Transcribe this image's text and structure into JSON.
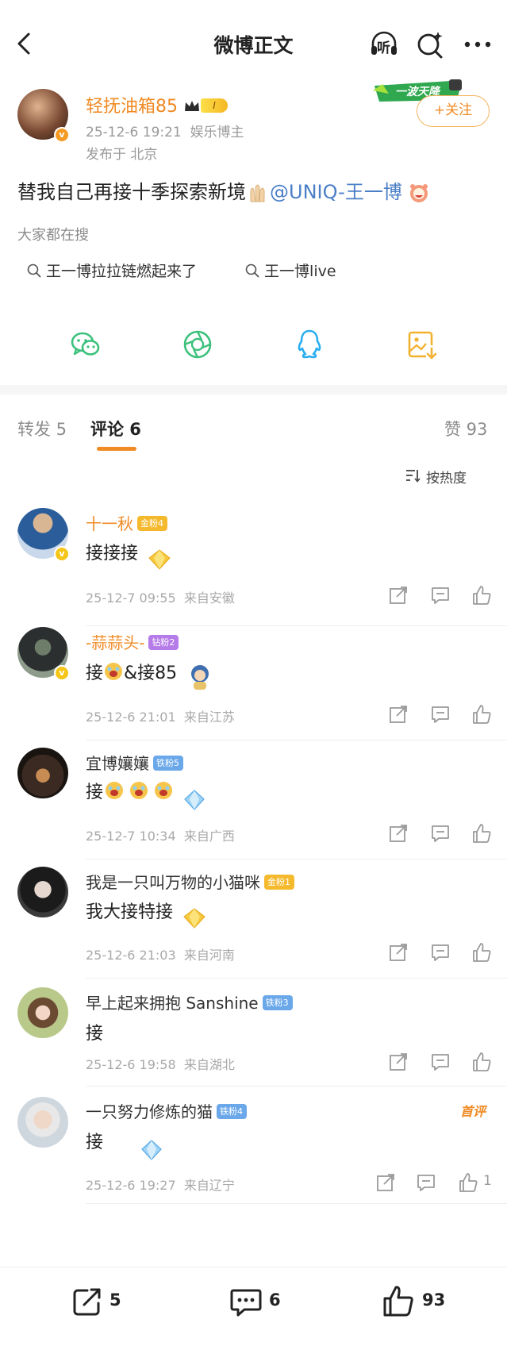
{
  "header": {
    "title": "微博正文",
    "back_icon": "chevron-left-icon",
    "listen_icon": "headphones-listen-icon",
    "listen_label": "听",
    "search_icon": "search-sparkle-icon",
    "more_icon": "more-dots-icon"
  },
  "author": {
    "name": "轻抚油箱85",
    "level_badge": "I",
    "time": "25-12-6 19:21",
    "role": "娱乐博主",
    "location": "发布于 北京",
    "verified_badge": "v",
    "follow_label": "+关注",
    "sticker_text": "一波天降"
  },
  "post": {
    "text": "替我自己再接十季探索新境",
    "mention": "@UNIQ-王一博"
  },
  "hot_search": {
    "label": "大家都在搜",
    "items": [
      "王一博拉拉链燃起来了",
      "王一博live"
    ]
  },
  "share": {
    "icons": [
      "wechat-icon",
      "moments-icon",
      "qq-icon",
      "save-image-icon"
    ]
  },
  "tabs": {
    "repost": "转发 5",
    "comment": "评论 6",
    "like": "赞 93"
  },
  "sort_label": "按热度",
  "comments": [
    {
      "name": "十一秋",
      "badge": "金粉4",
      "badge_color": "#f5b92e",
      "text": "接接接",
      "time": "25-12-7 09:55",
      "location": "来自安徽",
      "orange": true,
      "likes": ""
    },
    {
      "name": "-蒜蒜头-",
      "badge": "钻粉2",
      "badge_color": "#b57be8",
      "text": "接",
      "text2": "&接85",
      "time": "25-12-6 21:01",
      "location": "来自江苏",
      "orange": true,
      "likes": ""
    },
    {
      "name": "宜博孃孃",
      "badge": "铁粉5",
      "badge_color": "#6aa8ea",
      "text": "接",
      "time": "25-12-7 10:34",
      "location": "来自广西",
      "orange": false,
      "likes": ""
    },
    {
      "name": "我是一只叫万物的小猫咪",
      "badge": "金粉1",
      "badge_color": "#f5b92e",
      "text": "我大接特接",
      "time": "25-12-6 21:03",
      "location": "来自河南",
      "orange": false,
      "likes": ""
    },
    {
      "name": "早上起来拥抱 Sanshine",
      "badge": "铁粉3",
      "badge_color": "#6aa8ea",
      "text": "接",
      "time": "25-12-6 19:58",
      "location": "来自湖北",
      "orange": false,
      "likes": ""
    },
    {
      "name": "一只努力修炼的猫",
      "badge": "铁粉4",
      "badge_color": "#6aa8ea",
      "text": "接",
      "time": "25-12-6 19:27",
      "location": "来自辽宁",
      "orange": false,
      "likes": "1",
      "first_label": "首评"
    }
  ],
  "bottom_bar": {
    "repost_count": "5",
    "comment_count": "6",
    "like_count": "93"
  },
  "colors": {
    "accent": "#f08a24",
    "mention": "#4a7fc7",
    "wechat": "#3cc17c",
    "qq": "#2aaef0",
    "save": "#f2b230"
  }
}
